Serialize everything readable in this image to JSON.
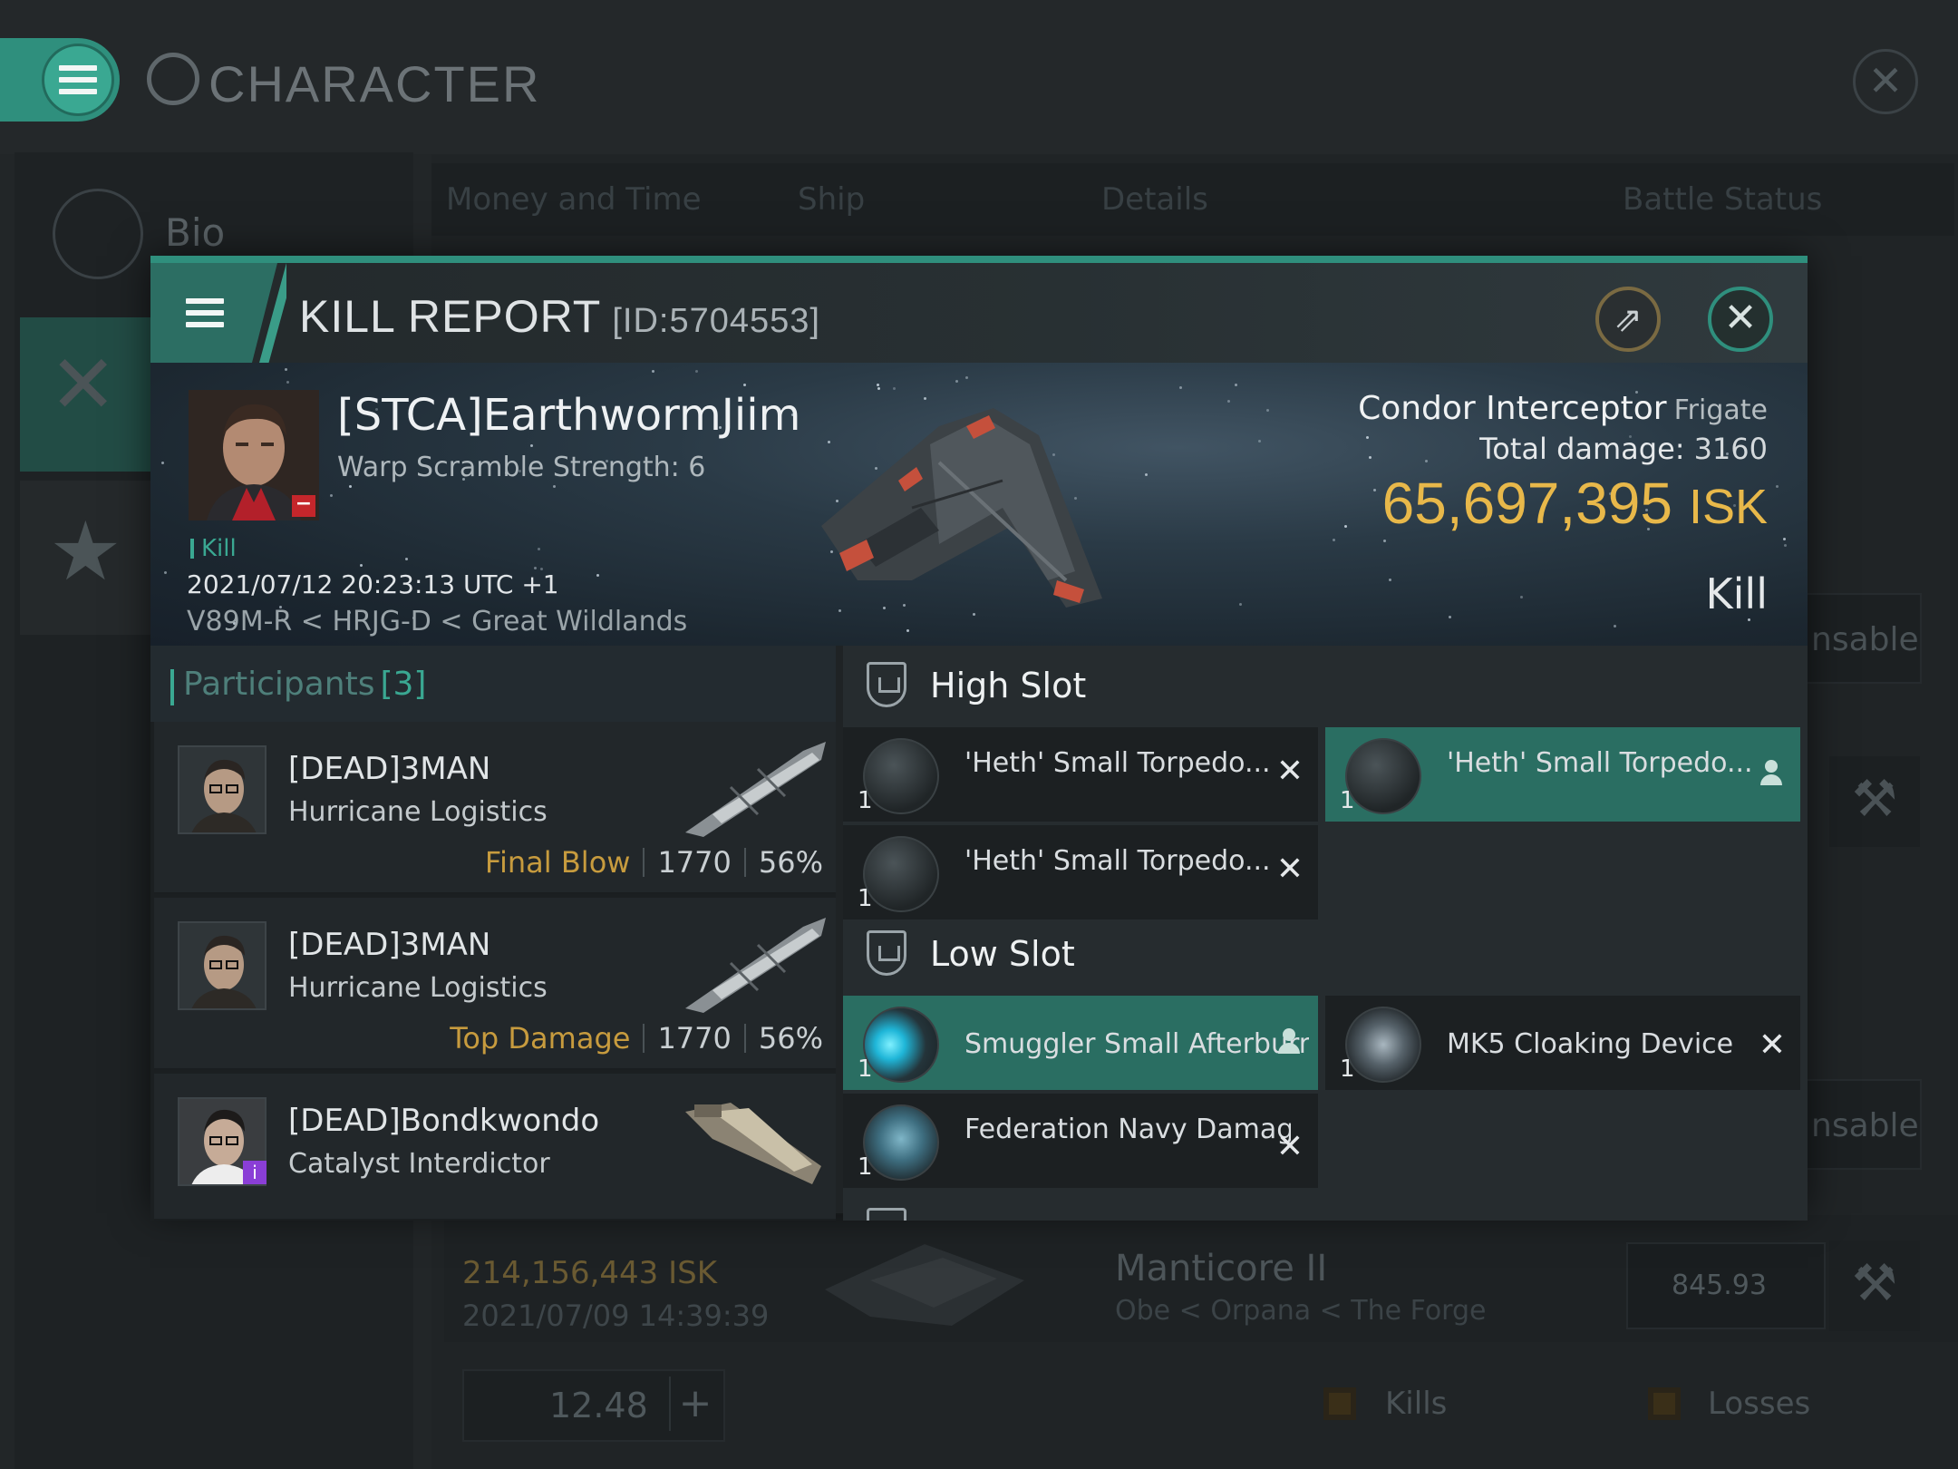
{
  "app": {
    "title": "CHARACTER"
  },
  "sidebar": {
    "bio_label": "Bio"
  },
  "background_tabs": [
    "Money and Time",
    "Ship",
    "Details",
    "Battle Status"
  ],
  "background_side_buttons": [
    "nsable",
    "nsable"
  ],
  "background_row": {
    "isk": "214,156,443  ISK",
    "date": "2021/07/09  14:39:39",
    "ship": "Manticore II",
    "location": "Obe < Orpana < The Forge",
    "value": "845.93"
  },
  "background_footer": {
    "value": "12.48",
    "legend_kills": "Kills",
    "legend_losses": "Losses"
  },
  "kill_report": {
    "title": "KILL REPORT",
    "id": "[ID:5704553]",
    "victim": {
      "name": "[STCA]EarthwormJiim",
      "warp_scramble": "Warp Scramble Strength: 6",
      "tag": "Kill",
      "date": "2021/07/12 20:23:13 UTC +1",
      "location": "V89M-R < HRJG-D < Great Wildlands"
    },
    "ship": {
      "name": "Condor Interceptor",
      "class": "Frigate",
      "total_damage_label": "Total damage:",
      "total_damage": "3160",
      "isk_value": "65,697,395",
      "isk_unit": "ISK",
      "result": "Kill"
    },
    "participants": {
      "label": "Participants",
      "count": "[3]",
      "items": [
        {
          "name": "[DEAD]3MAN",
          "ship": "Hurricane Logistics",
          "role": "Final Blow",
          "damage": "1770",
          "percent": "56%"
        },
        {
          "name": "[DEAD]3MAN",
          "ship": "Hurricane Logistics",
          "role": "Top Damage",
          "damage": "1770",
          "percent": "56%"
        },
        {
          "name": "[DEAD]Bondkwondo",
          "ship": "Catalyst Interdictor",
          "role": "",
          "damage": "",
          "percent": ""
        }
      ]
    },
    "fitting": {
      "high_slot_label": "High Slot",
      "low_slot_label": "Low Slot",
      "high": [
        {
          "name": "'Heth' Small Torpedo...",
          "qty": "1",
          "status": "destroyed"
        },
        {
          "name": "'Heth' Small Torpedo...",
          "qty": "1",
          "status": "dropped"
        },
        {
          "name": "'Heth' Small Torpedo...",
          "qty": "1",
          "status": "destroyed"
        }
      ],
      "low": [
        {
          "name": "Smuggler Small Afterburner",
          "qty": "1",
          "status": "dropped"
        },
        {
          "name": "MK5 Cloaking Device",
          "qty": "1",
          "status": "destroyed"
        },
        {
          "name": "Federation Navy Damage...",
          "qty": "1",
          "status": "destroyed"
        }
      ],
      "destroyed_mark": "✕"
    }
  },
  "colors": {
    "accent": "#2f8f7d",
    "isk": "#e8b84a",
    "role": "#c79b3e",
    "selected_row": "#2a6e62"
  }
}
